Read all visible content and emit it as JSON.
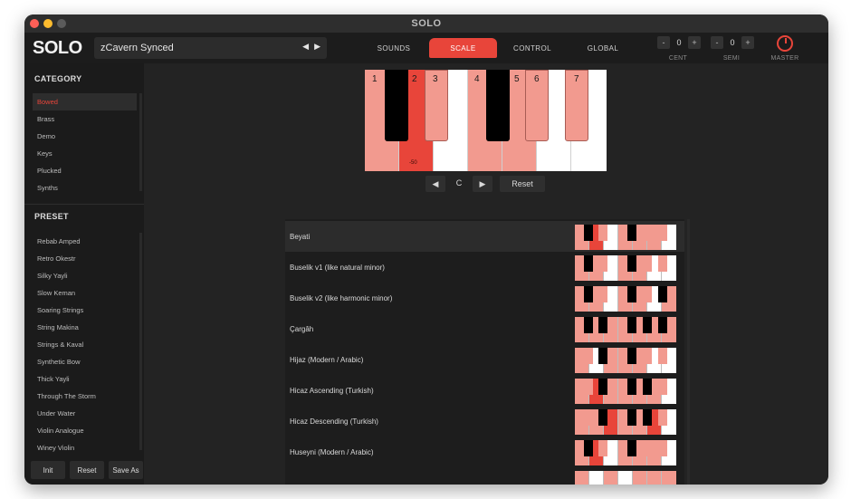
{
  "window": {
    "title": "SOLO"
  },
  "app": {
    "logo": "SOLO"
  },
  "preset_select": {
    "value": "zCavern Synced",
    "prev_icon": "triangle-left",
    "next_icon": "triangle-right"
  },
  "nav": {
    "tabs": [
      "SOUNDS",
      "SCALE",
      "CONTROL",
      "GLOBAL"
    ],
    "active": "SCALE"
  },
  "tuning": {
    "cent": {
      "label": "CENT",
      "value": "0",
      "minus": "-",
      "plus": "+"
    },
    "semi": {
      "label": "SEMI",
      "value": "0",
      "minus": "-",
      "plus": "+"
    },
    "master": {
      "label": "MASTER"
    }
  },
  "category": {
    "heading": "CATEGORY",
    "items": [
      "Bowed",
      "Brass",
      "Demo",
      "Keys",
      "Plucked",
      "Synths"
    ],
    "selected": "Bowed"
  },
  "preset": {
    "heading": "PRESET",
    "items": [
      "Rebab Amped",
      "Retro Okestr",
      "Silky Yayli",
      "Slow Keman",
      "Soaring Strings",
      "String Makina",
      "Strings & Kaval",
      "Synthetic Bow",
      "Thick Yayli",
      "Through The Storm",
      "Under Water",
      "Violin Analogue",
      "Winey Violin"
    ]
  },
  "sidebar_buttons": {
    "init": "Init",
    "reset": "Reset",
    "save_as": "Save As"
  },
  "keyboard": {
    "labels": [
      "1",
      "2",
      "3",
      "4",
      "5",
      "6",
      "7"
    ],
    "cent_label": "-50",
    "root_note": "C",
    "reset_label": "Reset",
    "colors": {
      "accent": "#e8453a",
      "salmon": "#f29a8f",
      "white": "#ffffff",
      "black": "#000000"
    }
  },
  "scales": [
    "Beyati",
    "Buselik v1 (like natural minor)",
    "Buselik v2 (like harmonic minor)",
    "Çargâh",
    "Hijaz (Modern / Arabic)",
    "Hicaz Ascending (Turkish)",
    "Hicaz Descending (Turkish)",
    "Huseyni (Modern / Arabic)"
  ],
  "selected_scale": "Beyati"
}
